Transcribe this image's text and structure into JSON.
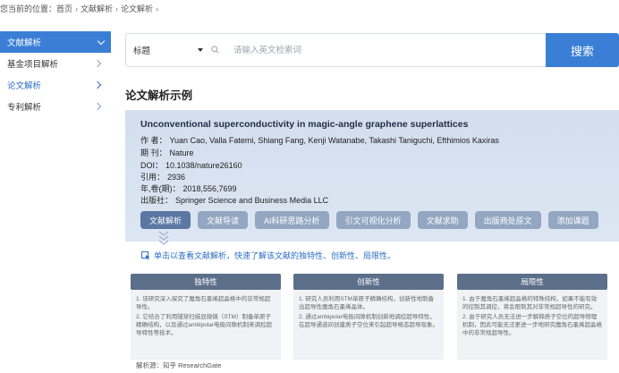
{
  "breadcrumb": {
    "prefix": "您当前的位置：",
    "items": [
      "首页",
      "文献解析",
      "论文解析"
    ]
  },
  "sidebar": {
    "header": "文献解析",
    "items": [
      {
        "label": "基金项目解析"
      },
      {
        "label": "论文解析"
      },
      {
        "label": "专利解析"
      }
    ]
  },
  "search": {
    "field_select": "标题",
    "placeholder": "请输入英文检索词",
    "value": "",
    "button_label": "搜索"
  },
  "section_title": "论文解析示例",
  "paper": {
    "title": "Unconventional superconductivity in magic-angle graphene superlattices",
    "authors_key": "作 者：",
    "authors": "Yuan Cao, Valla Fatemi, Shiang Fang, Kenji Watanabe, Takashi Taniguchi, Efthimios Kaxiras",
    "journal_key": "期 刊：",
    "journal": "Nature",
    "doi_key": "DOI：",
    "doi": "10.1038/nature26160",
    "cite_key": "引用：",
    "cite": "2936",
    "vol_key": "年,卷(期)：",
    "vol": "2018,556,7699",
    "publisher_key": "出版社：",
    "publisher": "Springer Science and Business Media LLC",
    "buttons": [
      "文献解析",
      "文献导读",
      "AI科研思路分析",
      "引文可视化分析",
      "文献求助",
      "出版商处原文",
      "添加课题"
    ]
  },
  "hint": "单击以查看文献解析，快速了解该文献的独特性、创新性、局限性。",
  "cards": [
    {
      "title": "独特性",
      "lines": [
        "1. 该研究深入探究了魔角石墨烯超晶格中的非常规超导性。",
        "2. 它结合了利用隧穿扫描显微镜（STM）制备单原子精确结构，以及通过ambipolar电极间隙机制来调控超导特性等技术。"
      ]
    },
    {
      "title": "创新性",
      "lines": [
        "1. 研究人员利用STM单原子精确结构，创新性地制备出超导性魔角石墨烯晶体。",
        "2. 通过ambipolar电极间隙机制创新地调控超导特性，在超导通道间创建质子空位来引起超导格态超导现象。"
      ]
    },
    {
      "title": "局限性",
      "lines": [
        "1. 由于魔角石墨烯超晶格的特殊结构，如果不能有效的控制其调控，将会限制其对非常规超导性的研究。",
        "2. 由于研究人员无法进一步解释质子空位的超导物理机制，因此可能无法更进一步地研究魔角石墨烯超晶格中的非常规超导性。"
      ]
    }
  ],
  "source": "解析源：知乎 ResearchGate",
  "colors": {
    "primary": "#3a7fd5",
    "button_active": "#5b77a3",
    "button": "#93a7c3",
    "card_head": "#5c6f8a"
  }
}
